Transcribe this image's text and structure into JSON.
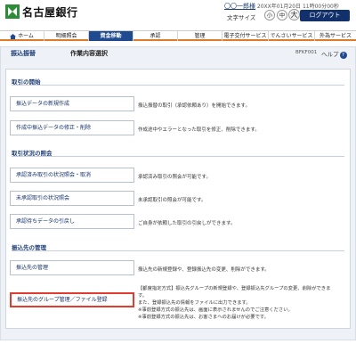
{
  "header": {
    "brand": "名古屋銀行",
    "user_name": "〇〇一郎様",
    "last_login": "20XX年01月20日 11時00分00秒",
    "font_size_label": "文字サイズ",
    "font_sizes": [
      "小",
      "中",
      "大"
    ],
    "logout_label": "ログアウト",
    "brand_color": "#12306b",
    "accent_color": "#e07a2b"
  },
  "nav": [
    {
      "label": "ホーム",
      "icon": "home-icon"
    },
    {
      "label": "明細照会"
    },
    {
      "label": "資金移動"
    },
    {
      "label": "承認"
    },
    {
      "label": "管理"
    },
    {
      "label": "電子交付サービス"
    },
    {
      "label": "でんさいサービス"
    },
    {
      "label": "外為サービス"
    }
  ],
  "page": {
    "title": "振込振替",
    "subtitle": "作業内容選択",
    "page_id": "BFKF001",
    "help_label": "ヘルプ",
    "help_icon": "question-icon"
  },
  "sections": [
    {
      "title": "取引の開始",
      "items": [
        {
          "button": "振込データの新規作成",
          "desc": [
            "振込振替の取引（承認依頼あり）を開始できます。"
          ]
        },
        {
          "button": "作成中振込データの修正・削除",
          "desc": [
            "作成途中やエラーとなった取引を修正、削除できます。"
          ]
        }
      ]
    },
    {
      "title": "取引状況の照会",
      "items": [
        {
          "button": "承認済み取引の状況照会・取消",
          "desc": [
            "承認済み取引の照会が可能です。"
          ]
        },
        {
          "button": "未承認取引の状況照会",
          "desc": [
            "未承認取引の照会が可能です。"
          ]
        },
        {
          "button": "承認待ちデータの引戻し",
          "desc": [
            "ご自身が依頼した取引の引戻しができます。"
          ]
        }
      ]
    },
    {
      "title": "振込先の管理",
      "items": [
        {
          "button": "振込先の管理",
          "desc": [
            "振込先の新規登録や、登録振込先の変更、削除ができます。"
          ]
        },
        {
          "button": "振込先のグループ管理／ファイル登録",
          "desc": [
            "【都度指定方式】振込先グループの新規登録や、登録振込先グループの変更、削除ができま",
            "す。",
            "また、登録振込先の情報をファイルに出力できます。",
            "※事前登録方式の振込先は、画面に表示されませんのでご注意ください。",
            "※事前登録方式の振込先は、お客さまへのお届けが必要です。"
          ]
        }
      ]
    }
  ]
}
